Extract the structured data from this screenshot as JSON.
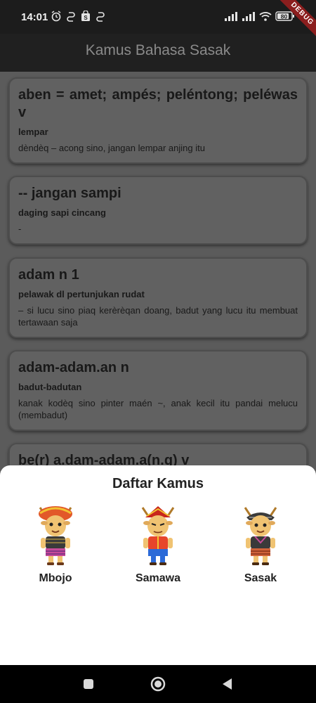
{
  "status_bar": {
    "time": "14:01",
    "battery": "80",
    "left_icons": [
      "alarm-icon",
      "sync-icon",
      "shopping-bag-icon",
      "sync-icon"
    ],
    "right_icons": [
      "signal-icon",
      "signal-icon",
      "wifi-icon",
      "battery-icon"
    ]
  },
  "debug_banner": "DEBUG",
  "app_bar": {
    "title": "Kamus Bahasa Sasak"
  },
  "entries": [
    {
      "word": "aben = amet; ampés; peléntong; peléwas v",
      "meaning": "lempar",
      "example": "dèndèq – acong sino, jangan lempar anjing itu"
    },
    {
      "word": "-- jangan sampi",
      "meaning": "daging sapi cincang",
      "example": "-"
    },
    {
      "word": "adam  n 1",
      "meaning": "pelawak dl pertunjukan rudat",
      "example": "– si lucu sino piaq kerèrèqan doang, badut yang lucu itu membuat tertawaan saja"
    },
    {
      "word": "adam-adam.an n",
      "meaning": "badut-badutan",
      "example": "kanak kodèq sino pinter maén ~, anak kecil itu pandai melucu (membadut)"
    },
    {
      "word": "be(r) a.dam-adam.a(n.g) v",
      "meaning": "",
      "example": ""
    }
  ],
  "sheet": {
    "title": "Daftar Kamus",
    "dictionaries": [
      {
        "label": "Mbojo",
        "headwear": "#e2582a",
        "shirt": "#3a3a3a",
        "sarong": "#c64a9a"
      },
      {
        "label": "Samawa",
        "headwear": "#c8261c",
        "shirt": "#e7452b",
        "sarong": "#2b6ad8"
      },
      {
        "label": "Sasak",
        "headwear": "#3b3b3b",
        "shirt": "#3a3a3a",
        "sarong": "#d0633a"
      }
    ]
  },
  "nav": {
    "buttons": [
      "square-icon",
      "circle-home-icon",
      "triangle-back-icon"
    ]
  },
  "colors": {
    "accent_debug": "#8b1e1e",
    "scrim": "#5b5b5b",
    "card": "#616161",
    "sheet": "#ffffff"
  }
}
